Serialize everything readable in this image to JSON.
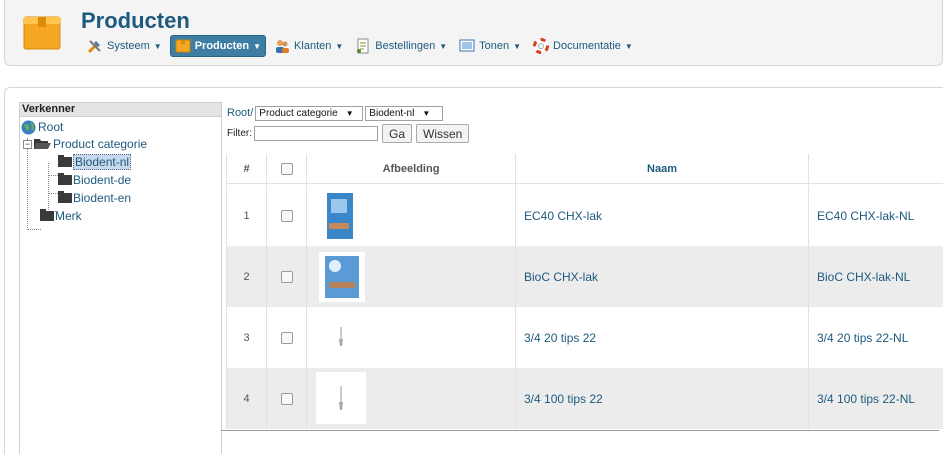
{
  "header": {
    "title": "Producten",
    "menu": [
      {
        "label": "Systeem",
        "icon": "tools-icon"
      },
      {
        "label": "Producten",
        "icon": "box-icon",
        "active": true
      },
      {
        "label": "Klanten",
        "icon": "users-icon"
      },
      {
        "label": "Bestellingen",
        "icon": "order-icon"
      },
      {
        "label": "Tonen",
        "icon": "display-icon"
      },
      {
        "label": "Documentatie",
        "icon": "lifebuoy-icon"
      }
    ]
  },
  "sidebar": {
    "title": "Verkenner",
    "tree": {
      "root": "Root",
      "product_categorie": "Product categorie",
      "biodent_nl": "Biodent-nl",
      "biodent_de": "Biodent-de",
      "biodent_en": "Biodent-en",
      "merk": "Merk"
    }
  },
  "toolbar": {
    "crumb_root": "Root/",
    "select1": "Product categorie",
    "select2": "Biodent-nl",
    "filter_label": "Filter:",
    "filter_value": "",
    "go_label": "Ga",
    "clear_label": "Wissen"
  },
  "table": {
    "headers": {
      "num": "#",
      "image": "Afbeelding",
      "name": "Naam",
      "extra": ""
    },
    "rows": [
      {
        "num": "1",
        "name": "EC40 CHX-lak",
        "extra": "EC40 CHX-lak-NL"
      },
      {
        "num": "2",
        "name": "BioC CHX-lak",
        "extra": "BioC CHX-lak-NL"
      },
      {
        "num": "3",
        "name": "3/4 20 tips 22",
        "extra": "3/4 20 tips 22-NL"
      },
      {
        "num": "4",
        "name": "3/4 100 tips 22",
        "extra": "3/4 100 tips 22-NL"
      }
    ]
  },
  "colors": {
    "accent": "#1d5a7e",
    "active_menu": "#3e7ea4",
    "row_alt": "#ececec"
  }
}
